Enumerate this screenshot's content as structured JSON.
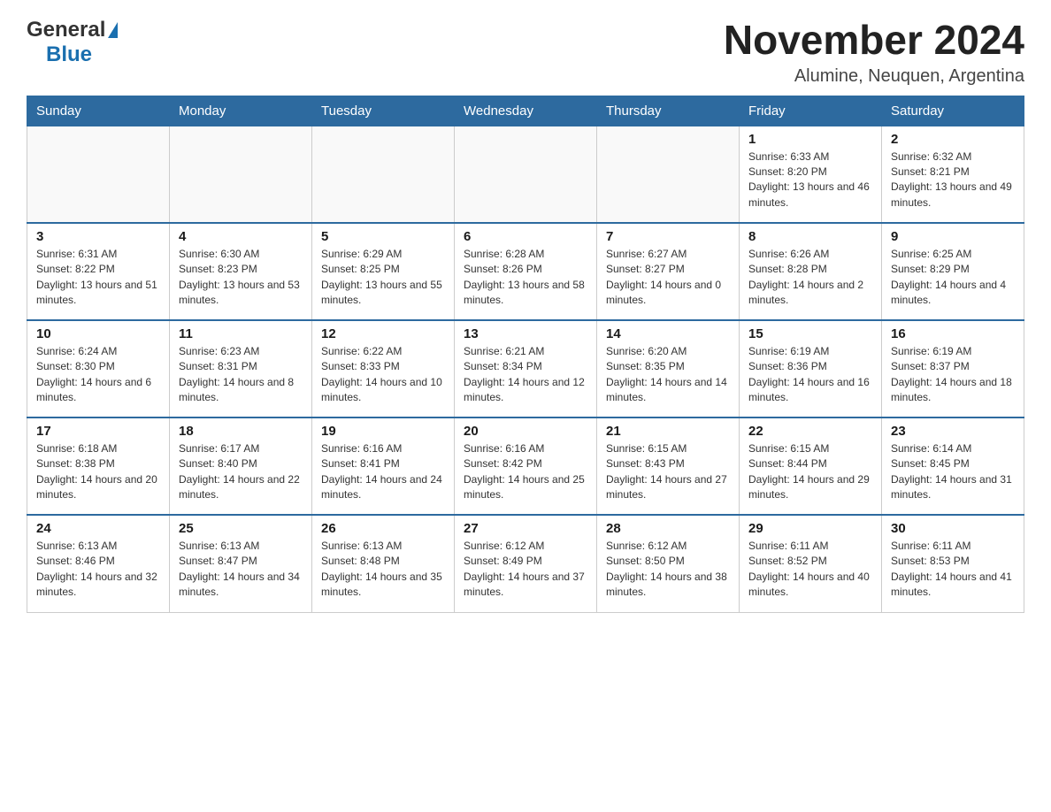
{
  "header": {
    "logo_general": "General",
    "logo_blue": "Blue",
    "month_title": "November 2024",
    "location": "Alumine, Neuquen, Argentina"
  },
  "days_of_week": [
    "Sunday",
    "Monday",
    "Tuesday",
    "Wednesday",
    "Thursday",
    "Friday",
    "Saturday"
  ],
  "weeks": [
    [
      {
        "day": "",
        "info": ""
      },
      {
        "day": "",
        "info": ""
      },
      {
        "day": "",
        "info": ""
      },
      {
        "day": "",
        "info": ""
      },
      {
        "day": "",
        "info": ""
      },
      {
        "day": "1",
        "info": "Sunrise: 6:33 AM\nSunset: 8:20 PM\nDaylight: 13 hours and 46 minutes."
      },
      {
        "day": "2",
        "info": "Sunrise: 6:32 AM\nSunset: 8:21 PM\nDaylight: 13 hours and 49 minutes."
      }
    ],
    [
      {
        "day": "3",
        "info": "Sunrise: 6:31 AM\nSunset: 8:22 PM\nDaylight: 13 hours and 51 minutes."
      },
      {
        "day": "4",
        "info": "Sunrise: 6:30 AM\nSunset: 8:23 PM\nDaylight: 13 hours and 53 minutes."
      },
      {
        "day": "5",
        "info": "Sunrise: 6:29 AM\nSunset: 8:25 PM\nDaylight: 13 hours and 55 minutes."
      },
      {
        "day": "6",
        "info": "Sunrise: 6:28 AM\nSunset: 8:26 PM\nDaylight: 13 hours and 58 minutes."
      },
      {
        "day": "7",
        "info": "Sunrise: 6:27 AM\nSunset: 8:27 PM\nDaylight: 14 hours and 0 minutes."
      },
      {
        "day": "8",
        "info": "Sunrise: 6:26 AM\nSunset: 8:28 PM\nDaylight: 14 hours and 2 minutes."
      },
      {
        "day": "9",
        "info": "Sunrise: 6:25 AM\nSunset: 8:29 PM\nDaylight: 14 hours and 4 minutes."
      }
    ],
    [
      {
        "day": "10",
        "info": "Sunrise: 6:24 AM\nSunset: 8:30 PM\nDaylight: 14 hours and 6 minutes."
      },
      {
        "day": "11",
        "info": "Sunrise: 6:23 AM\nSunset: 8:31 PM\nDaylight: 14 hours and 8 minutes."
      },
      {
        "day": "12",
        "info": "Sunrise: 6:22 AM\nSunset: 8:33 PM\nDaylight: 14 hours and 10 minutes."
      },
      {
        "day": "13",
        "info": "Sunrise: 6:21 AM\nSunset: 8:34 PM\nDaylight: 14 hours and 12 minutes."
      },
      {
        "day": "14",
        "info": "Sunrise: 6:20 AM\nSunset: 8:35 PM\nDaylight: 14 hours and 14 minutes."
      },
      {
        "day": "15",
        "info": "Sunrise: 6:19 AM\nSunset: 8:36 PM\nDaylight: 14 hours and 16 minutes."
      },
      {
        "day": "16",
        "info": "Sunrise: 6:19 AM\nSunset: 8:37 PM\nDaylight: 14 hours and 18 minutes."
      }
    ],
    [
      {
        "day": "17",
        "info": "Sunrise: 6:18 AM\nSunset: 8:38 PM\nDaylight: 14 hours and 20 minutes."
      },
      {
        "day": "18",
        "info": "Sunrise: 6:17 AM\nSunset: 8:40 PM\nDaylight: 14 hours and 22 minutes."
      },
      {
        "day": "19",
        "info": "Sunrise: 6:16 AM\nSunset: 8:41 PM\nDaylight: 14 hours and 24 minutes."
      },
      {
        "day": "20",
        "info": "Sunrise: 6:16 AM\nSunset: 8:42 PM\nDaylight: 14 hours and 25 minutes."
      },
      {
        "day": "21",
        "info": "Sunrise: 6:15 AM\nSunset: 8:43 PM\nDaylight: 14 hours and 27 minutes."
      },
      {
        "day": "22",
        "info": "Sunrise: 6:15 AM\nSunset: 8:44 PM\nDaylight: 14 hours and 29 minutes."
      },
      {
        "day": "23",
        "info": "Sunrise: 6:14 AM\nSunset: 8:45 PM\nDaylight: 14 hours and 31 minutes."
      }
    ],
    [
      {
        "day": "24",
        "info": "Sunrise: 6:13 AM\nSunset: 8:46 PM\nDaylight: 14 hours and 32 minutes."
      },
      {
        "day": "25",
        "info": "Sunrise: 6:13 AM\nSunset: 8:47 PM\nDaylight: 14 hours and 34 minutes."
      },
      {
        "day": "26",
        "info": "Sunrise: 6:13 AM\nSunset: 8:48 PM\nDaylight: 14 hours and 35 minutes."
      },
      {
        "day": "27",
        "info": "Sunrise: 6:12 AM\nSunset: 8:49 PM\nDaylight: 14 hours and 37 minutes."
      },
      {
        "day": "28",
        "info": "Sunrise: 6:12 AM\nSunset: 8:50 PM\nDaylight: 14 hours and 38 minutes."
      },
      {
        "day": "29",
        "info": "Sunrise: 6:11 AM\nSunset: 8:52 PM\nDaylight: 14 hours and 40 minutes."
      },
      {
        "day": "30",
        "info": "Sunrise: 6:11 AM\nSunset: 8:53 PM\nDaylight: 14 hours and 41 minutes."
      }
    ]
  ]
}
